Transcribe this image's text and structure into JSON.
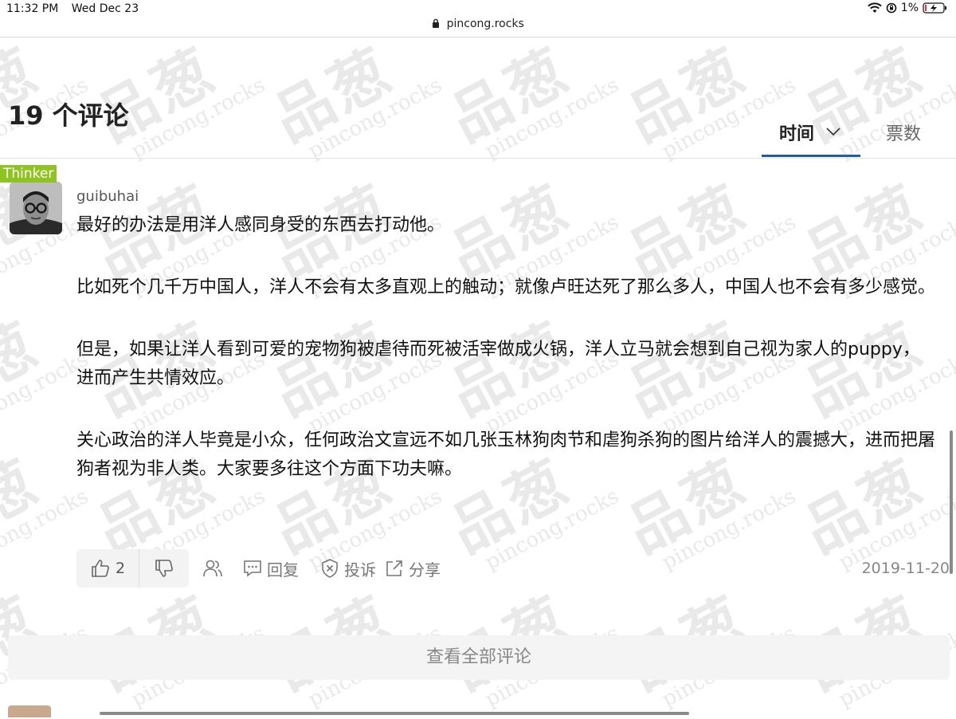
{
  "status_bar": {
    "time": "11:32 PM",
    "date": "Wed Dec 23",
    "battery": "1%"
  },
  "browser": {
    "url": "pincong.rocks"
  },
  "watermark": {
    "brand": "品葱",
    "domain": "pincong.rocks"
  },
  "comments_section": {
    "title": "19 个评论",
    "sort_tabs": [
      {
        "label": "时间",
        "active": true,
        "icon": "chevron-down-icon"
      },
      {
        "label": "票数",
        "active": false
      }
    ]
  },
  "comment": {
    "badge": "Thinker",
    "username": "guibuhai",
    "paragraphs": [
      "最好的办法是用洋人感同身受的东西去打动他。",
      "比如死个几千万中国人，洋人不会有太多直观上的触动；就像卢旺达死了那么多人，中国人也不会有多少感觉。",
      "但是，如果让洋人看到可爱的宠物狗被虐待而死被活宰做成火锅，洋人立马就会想到自己视为家人的puppy，进而产生共情效应。",
      "关心政治的洋人毕竟是小众，任何政治文宣远不如几张玉林狗肉节和虐狗杀狗的图片给洋人的震撼大，进而把屠狗者视为非人类。大家要多往这个方面下功夫嘛。"
    ],
    "upvotes": "2",
    "actions": {
      "reply": "回复",
      "report": "投诉",
      "share": "分享"
    },
    "date": "2019-11-20"
  },
  "view_all_label": "查看全部评论",
  "colors": {
    "accent": "#1e5dab",
    "badge": "#8fc31f"
  }
}
